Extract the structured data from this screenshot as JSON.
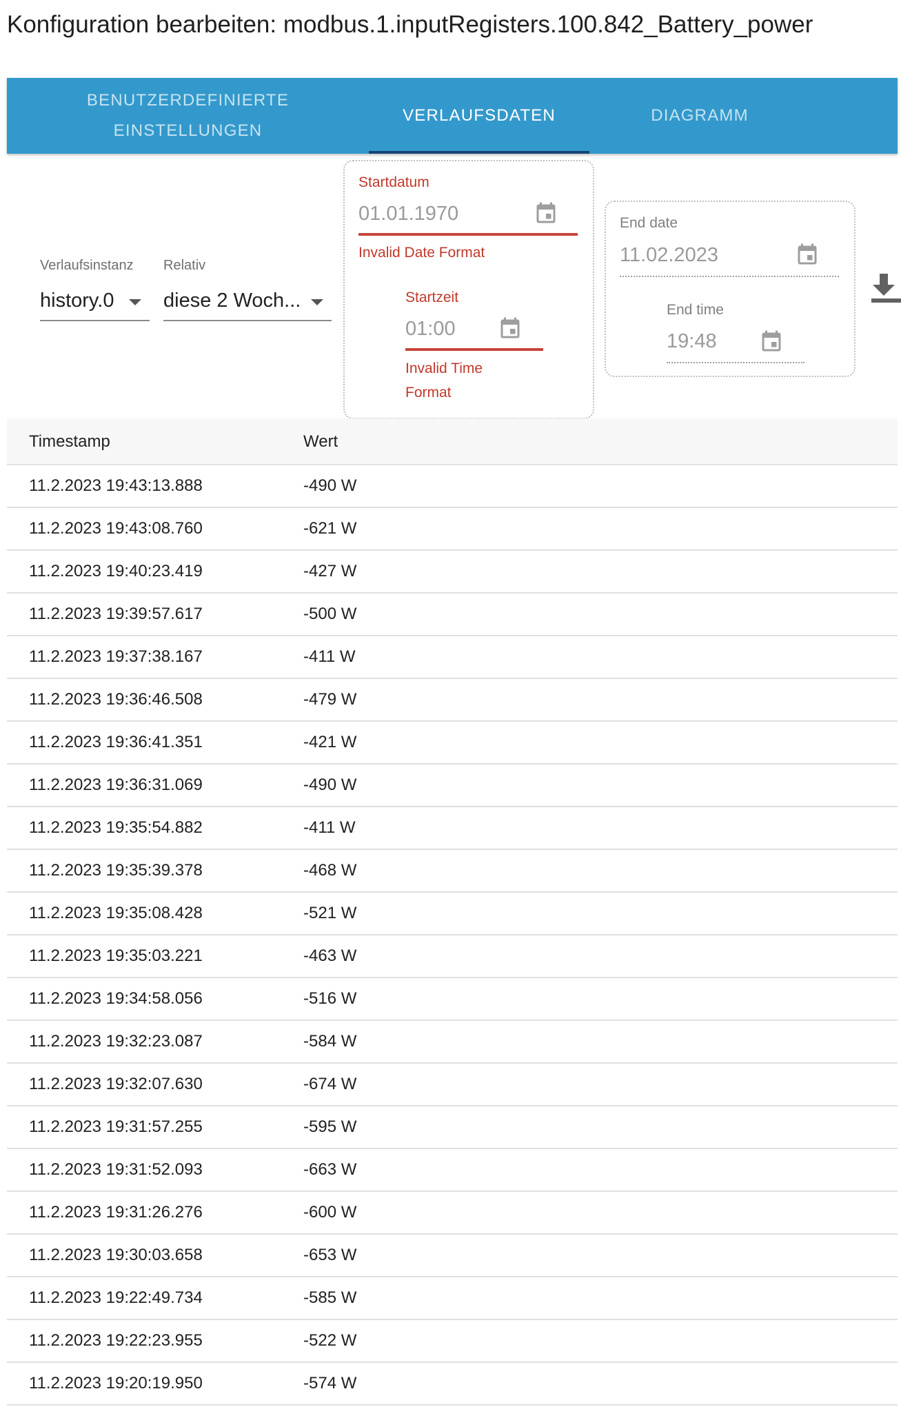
{
  "title": "Konfiguration bearbeiten: modbus.1.inputRegisters.100.842_Battery_power",
  "tabs": [
    {
      "line1": "BENUTZERDEFINIERTE",
      "line2": "EINSTELLUNGEN",
      "active": false
    },
    {
      "line1": "VERLAUFSDATEN",
      "line2": "",
      "active": true
    },
    {
      "line1": "DIAGRAMM",
      "line2": "",
      "active": false
    }
  ],
  "instance": {
    "label": "Verlaufsinstanz",
    "value": "history.0"
  },
  "relative": {
    "label": "Relativ",
    "value": "diese 2 Woch..."
  },
  "start": {
    "date_label": "Startdatum",
    "date_value": "01.01.1970",
    "date_error": "Invalid Date Format",
    "time_label": "Startzeit",
    "time_value": "01:00",
    "time_error_1": "Invalid Time",
    "time_error_2": "Format"
  },
  "end": {
    "date_label": "End date",
    "date_value": "11.02.2023",
    "time_label": "End time",
    "time_value": "19:48"
  },
  "icons": {
    "calendar": "calendar-icon",
    "download": "download-icon"
  },
  "colors": {
    "tab_bar": "#3399cc",
    "indicator": "#164477",
    "error": "#c0392b"
  },
  "table": {
    "headers": {
      "timestamp": "Timestamp",
      "value": "Wert"
    },
    "rows": [
      {
        "ts": "11.2.2023 19:43:13.888",
        "val": "-490 W"
      },
      {
        "ts": "11.2.2023 19:43:08.760",
        "val": "-621 W"
      },
      {
        "ts": "11.2.2023 19:40:23.419",
        "val": "-427 W"
      },
      {
        "ts": "11.2.2023 19:39:57.617",
        "val": "-500 W"
      },
      {
        "ts": "11.2.2023 19:37:38.167",
        "val": "-411 W"
      },
      {
        "ts": "11.2.2023 19:36:46.508",
        "val": "-479 W"
      },
      {
        "ts": "11.2.2023 19:36:41.351",
        "val": "-421 W"
      },
      {
        "ts": "11.2.2023 19:36:31.069",
        "val": "-490 W"
      },
      {
        "ts": "11.2.2023 19:35:54.882",
        "val": "-411 W"
      },
      {
        "ts": "11.2.2023 19:35:39.378",
        "val": "-468 W"
      },
      {
        "ts": "11.2.2023 19:35:08.428",
        "val": "-521 W"
      },
      {
        "ts": "11.2.2023 19:35:03.221",
        "val": "-463 W"
      },
      {
        "ts": "11.2.2023 19:34:58.056",
        "val": "-516 W"
      },
      {
        "ts": "11.2.2023 19:32:23.087",
        "val": "-584 W"
      },
      {
        "ts": "11.2.2023 19:32:07.630",
        "val": "-674 W"
      },
      {
        "ts": "11.2.2023 19:31:57.255",
        "val": "-595 W"
      },
      {
        "ts": "11.2.2023 19:31:52.093",
        "val": "-663 W"
      },
      {
        "ts": "11.2.2023 19:31:26.276",
        "val": "-600 W"
      },
      {
        "ts": "11.2.2023 19:30:03.658",
        "val": "-653 W"
      },
      {
        "ts": "11.2.2023 19:22:49.734",
        "val": "-585 W"
      },
      {
        "ts": "11.2.2023 19:22:23.955",
        "val": "-522 W"
      },
      {
        "ts": "11.2.2023 19:20:19.950",
        "val": "-574 W"
      }
    ]
  }
}
